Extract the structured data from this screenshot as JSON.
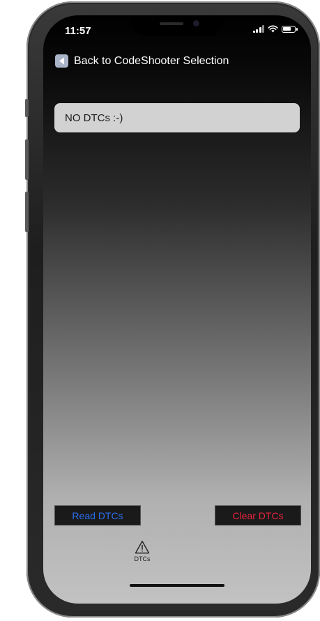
{
  "status_bar": {
    "time": "11:57"
  },
  "nav": {
    "back_label": "Back to CodeShooter Selection"
  },
  "dtc_field": {
    "value": "NO DTCs :-)"
  },
  "actions": {
    "read_label": "Read DTCs",
    "clear_label": "Clear DTCs",
    "read_color": "#2a6ef0",
    "clear_color": "#e8233c"
  },
  "tab_bar": {
    "items": [
      {
        "label": "DTCs",
        "icon": "warning-triangle-icon"
      }
    ]
  }
}
